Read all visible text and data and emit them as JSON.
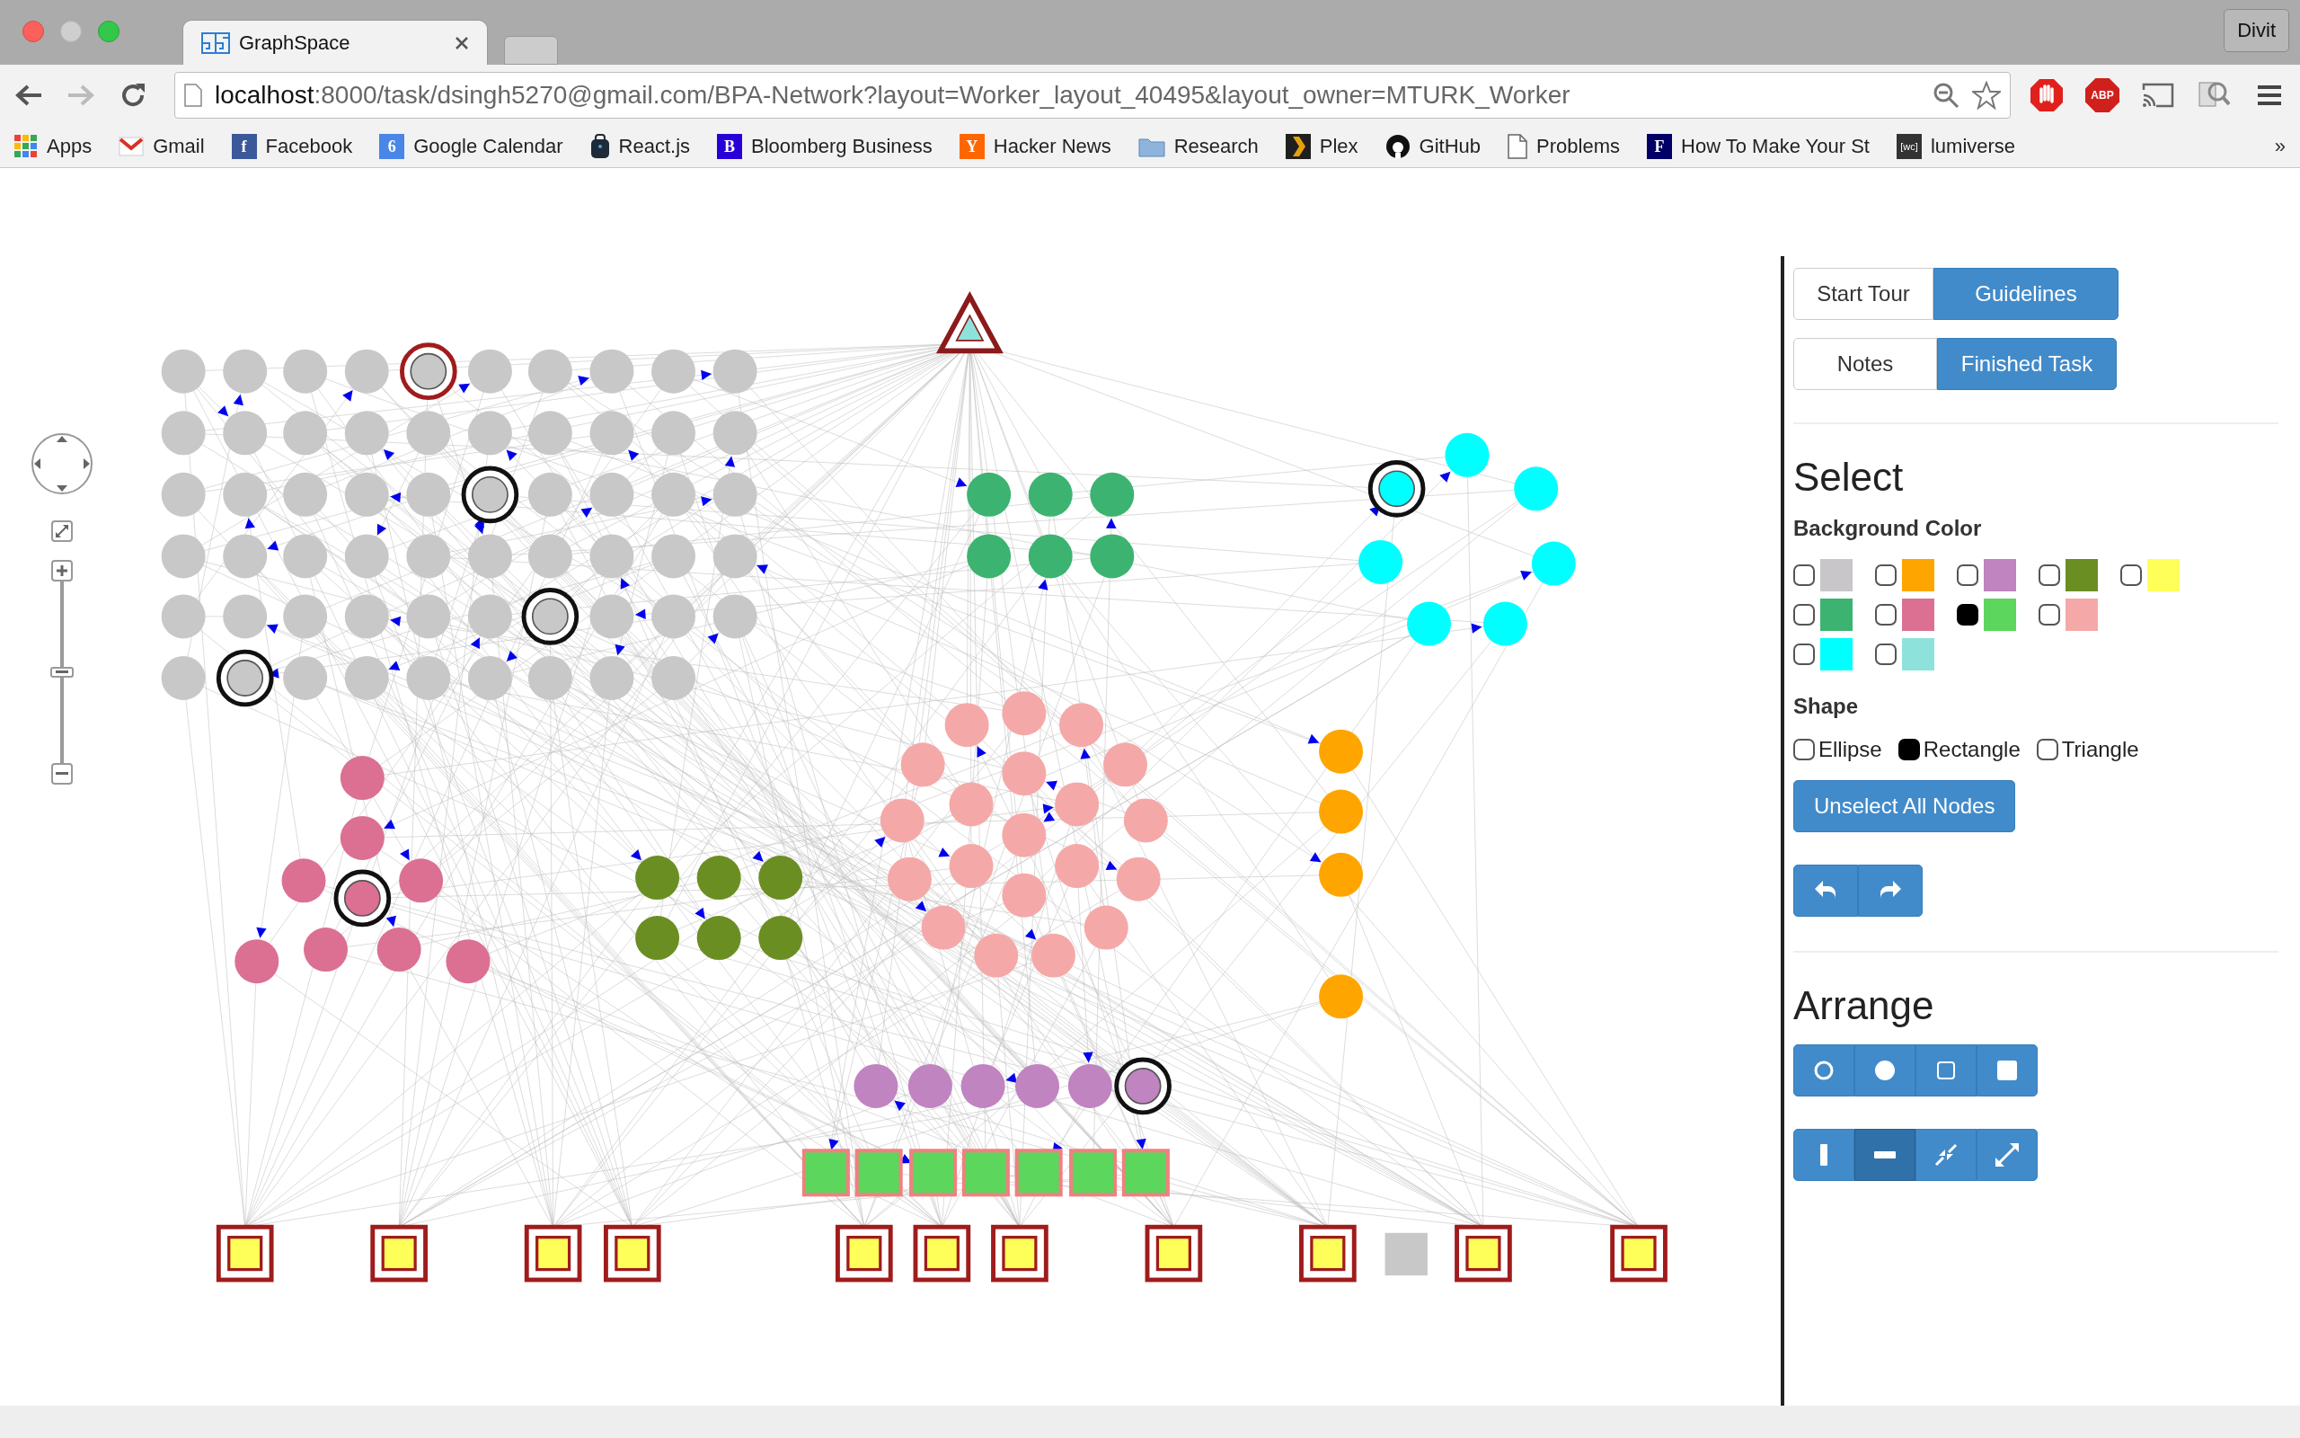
{
  "window": {
    "tab_title": "GraphSpace",
    "profile": "Divit"
  },
  "address_bar": {
    "host": "localhost",
    "path": ":8000/task/dsingh5270@gmail.com/BPA-Network?layout=Worker_layout_40495&layout_owner=MTURK_Worker"
  },
  "extensions": {
    "abp_label": "ABP"
  },
  "bookmarks": [
    {
      "label": "Apps",
      "kind": "apps"
    },
    {
      "label": "Gmail",
      "kind": "mail"
    },
    {
      "label": "Facebook",
      "kind": "letter",
      "icon_text": "f",
      "color": "#3b5998"
    },
    {
      "label": "Google Calendar",
      "kind": "letter",
      "icon_text": "6",
      "color": "#4a86e8"
    },
    {
      "label": "React.js",
      "kind": "bag"
    },
    {
      "label": "Bloomberg Business",
      "kind": "letter",
      "icon_text": "B",
      "color": "#2800d7"
    },
    {
      "label": "Hacker News",
      "kind": "letter",
      "icon_text": "Y",
      "color": "#ff6600"
    },
    {
      "label": "Research",
      "kind": "folder"
    },
    {
      "label": "Plex",
      "kind": "chevron"
    },
    {
      "label": "GitHub",
      "kind": "github"
    },
    {
      "label": "Problems",
      "kind": "page"
    },
    {
      "label": "How To Make Your St",
      "kind": "letter",
      "icon_text": "F",
      "color": "#000066"
    },
    {
      "label": "lumiverse",
      "kind": "letter",
      "icon_text": "[wc]",
      "color": "#333333"
    }
  ],
  "bookmarks_overflow": "»",
  "zoom_controls": {
    "level": 0.5
  },
  "panel": {
    "button_rows": [
      [
        {
          "label": "Start Tour",
          "kind": "default"
        },
        {
          "label": "Guidelines",
          "kind": "primary"
        }
      ],
      [
        {
          "label": "Notes",
          "kind": "default"
        },
        {
          "label": "Finished Task",
          "kind": "primary"
        }
      ]
    ],
    "select": {
      "title": "Select",
      "color_label": "Background Color",
      "color_rows": [
        [
          {
            "color": "#c8c6c8",
            "checked": false
          },
          {
            "color": "#ffa500",
            "checked": false
          },
          {
            "color": "#c084c0",
            "checked": false
          },
          {
            "color": "#6b8e23",
            "checked": false
          },
          {
            "color": "#ffff5a",
            "checked": false
          }
        ],
        [
          {
            "color": "#3cb371",
            "checked": false
          },
          {
            "color": "#db7093",
            "checked": false
          },
          {
            "color": "#5cd65c",
            "checked": true
          },
          {
            "color": "#f4a9a8",
            "checked": false
          }
        ],
        [
          {
            "color": "#00ffff",
            "checked": false
          },
          {
            "color": "#8de2dc",
            "checked": false
          }
        ]
      ],
      "shape_label": "Shape",
      "shapes": [
        {
          "label": "Ellipse",
          "checked": false
        },
        {
          "label": "Rectangle",
          "checked": true
        },
        {
          "label": "Triangle",
          "checked": false
        }
      ],
      "unselect_button": "Unselect All Nodes"
    },
    "arrange": {
      "title": "Arrange",
      "layout_buttons": [
        {
          "kind": "circle-outline"
        },
        {
          "kind": "circle-filled"
        },
        {
          "kind": "square-outline"
        },
        {
          "kind": "square-filled"
        }
      ],
      "tool_buttons": [
        {
          "kind": "vertical",
          "selected": false
        },
        {
          "kind": "horizontal",
          "selected": true
        },
        {
          "kind": "compress",
          "selected": false
        },
        {
          "kind": "expand",
          "selected": false
        }
      ]
    }
  }
}
